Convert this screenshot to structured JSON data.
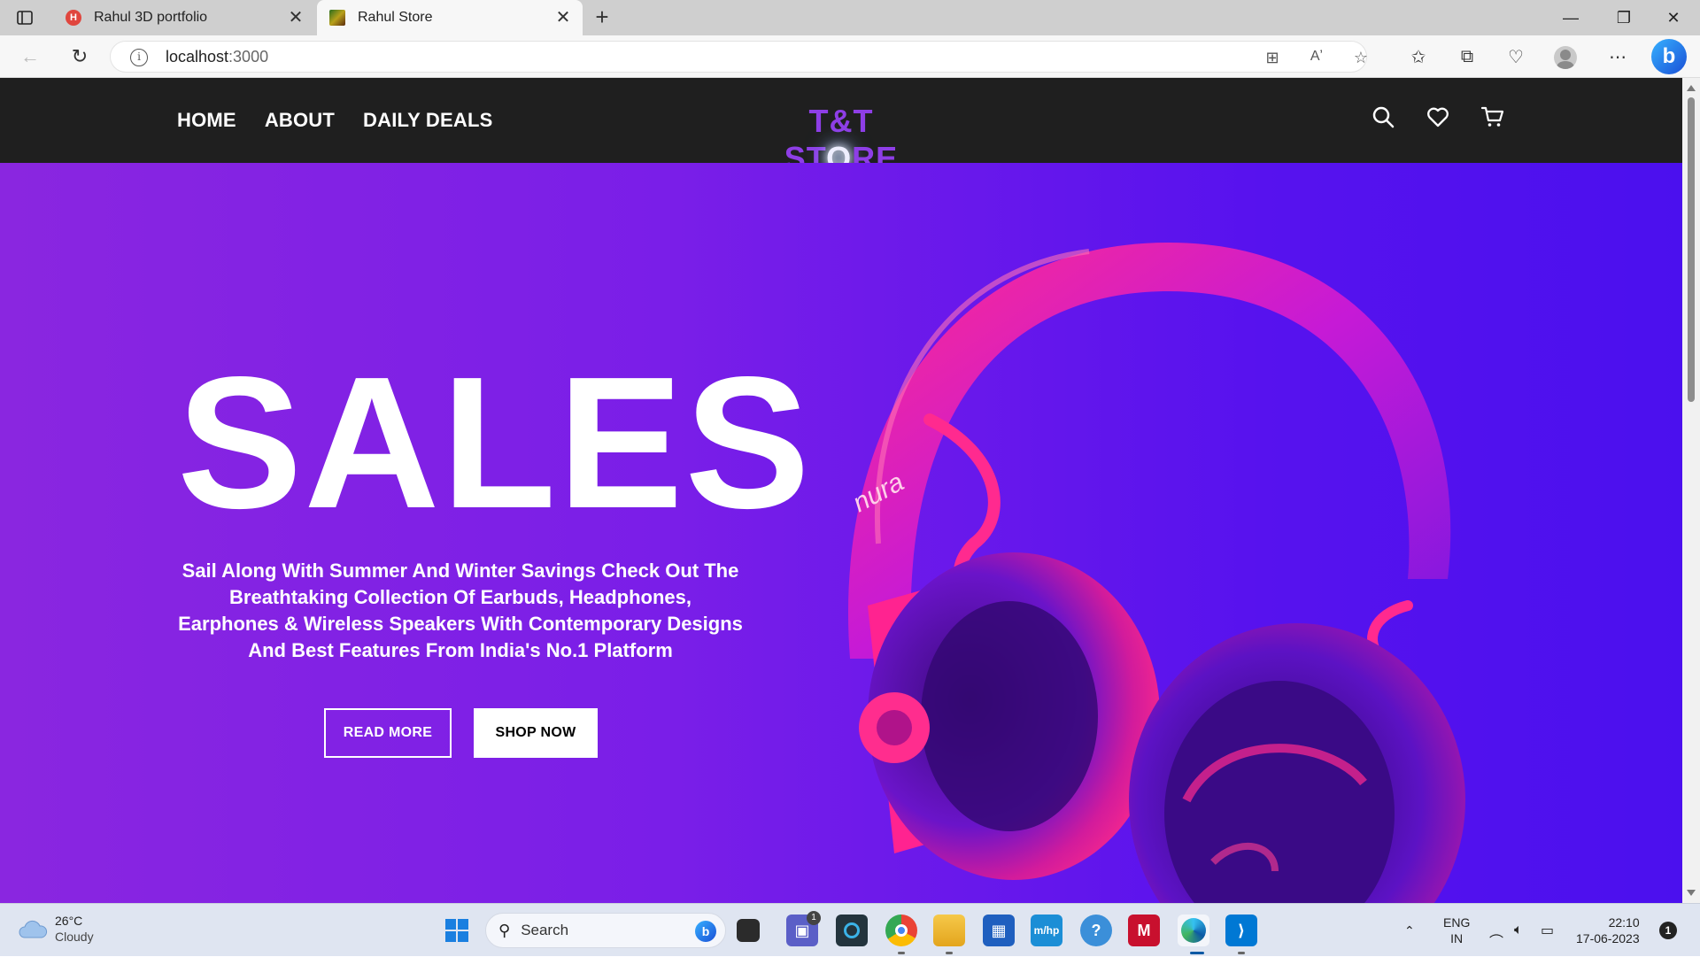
{
  "browser": {
    "tabs": [
      {
        "title": "Rahul 3D portfolio",
        "active": false
      },
      {
        "title": "Rahul Store",
        "active": true
      }
    ],
    "address": {
      "host": "localhost",
      "port": ":3000"
    }
  },
  "site": {
    "nav": {
      "home": "HOME",
      "about": "ABOUT",
      "deals": "DAILY DEALS"
    },
    "logo": {
      "before": "T&T ST",
      "glow": "O",
      "after": "RE"
    },
    "icons": [
      "search-icon",
      "heart-icon",
      "cart-icon"
    ],
    "hero": {
      "title": "SALES",
      "description": "Sail Along With Summer And Winter Savings  Check Out The Breathtaking Collection Of Earbuds, Headphones, Earphones & Wireless Speakers With Contemporary Designs And Best Features From India's No.1 Platform",
      "read_more": "READ MORE",
      "shop_now": "SHOP NOW",
      "product_brand": "nura"
    },
    "colors": {
      "nav_bg": "#1f1f1f",
      "hero_start": "#8a26e0",
      "hero_end": "#4b10ee",
      "logo": "#8e3ee6",
      "headphone": "#ff1f8e"
    }
  },
  "taskbar": {
    "weather": {
      "temp": "26°C",
      "condition": "Cloudy"
    },
    "search_label": "Search",
    "teams_badge": "1",
    "language": {
      "line1": "ENG",
      "line2": "IN"
    },
    "time": "22:10",
    "date": "17-06-2023",
    "notifications": "1"
  }
}
